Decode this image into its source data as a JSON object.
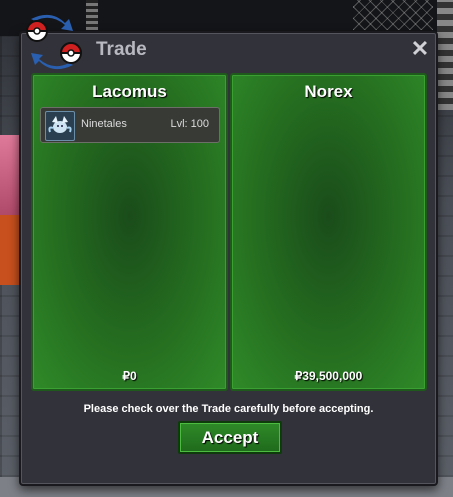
{
  "window": {
    "title": "Trade",
    "close_icon": "close-icon"
  },
  "left_panel": {
    "player_name": "Lacomus",
    "money": "₽0",
    "items": [
      {
        "name": "Ninetales",
        "level": "Lvl: 100",
        "icon": "ninetales-sprite-icon"
      }
    ]
  },
  "right_panel": {
    "player_name": "Norex",
    "money": "₽39,500,000",
    "items": []
  },
  "notice": "Please check over the Trade carefully before accepting.",
  "accept_label": "Accept",
  "colors": {
    "panel_green": "#2f8a28",
    "window_bg": "#32323a",
    "title_gray": "#b8b8c0"
  }
}
